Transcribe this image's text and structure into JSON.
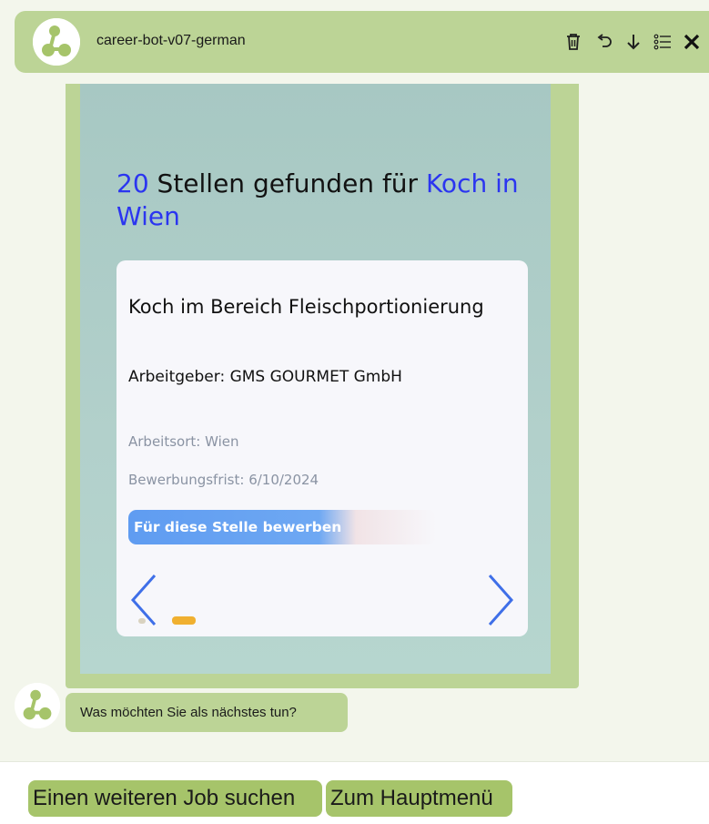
{
  "header": {
    "bot_name": "career-bot-v07-german",
    "avatar_icon": "bot-logo-icon",
    "toolbar": [
      {
        "name": "delete",
        "icon": "trash-icon"
      },
      {
        "name": "restart",
        "icon": "undo-icon"
      },
      {
        "name": "download",
        "icon": "arrow-down-icon"
      },
      {
        "name": "menu",
        "icon": "list-icon"
      },
      {
        "name": "close",
        "icon": "close-icon"
      }
    ]
  },
  "results": {
    "count": "20",
    "text_middle": " Stellen gefunden für ",
    "query": "Koch in Wien"
  },
  "job_card": {
    "title": "Koch im Bereich Fleischportionierung",
    "employer": "Arbeitgeber: GMS GOURMET GmbH",
    "location": "Arbeitsort: Wien",
    "deadline": "Bewerbungsfrist: 6/10/2024",
    "apply_label": "Für diese Stelle bewerben"
  },
  "carousel": {
    "total_dots": 2,
    "active_index": 1
  },
  "bot_message": "Was möchten Sie als nächstes tun?",
  "quick_replies": [
    "Einen weiteren Job suchen",
    "Zum Hauptmenü"
  ],
  "colors": {
    "header_bg": "#bcd496",
    "chat_bg": "#f3f6ec",
    "highlight_text": "#2b35f0",
    "apply_button": "#5f9cf1",
    "arrow": "#3f6fe8",
    "active_dot": "#f0b030",
    "quick_reply_bg": "#a6c46a"
  }
}
